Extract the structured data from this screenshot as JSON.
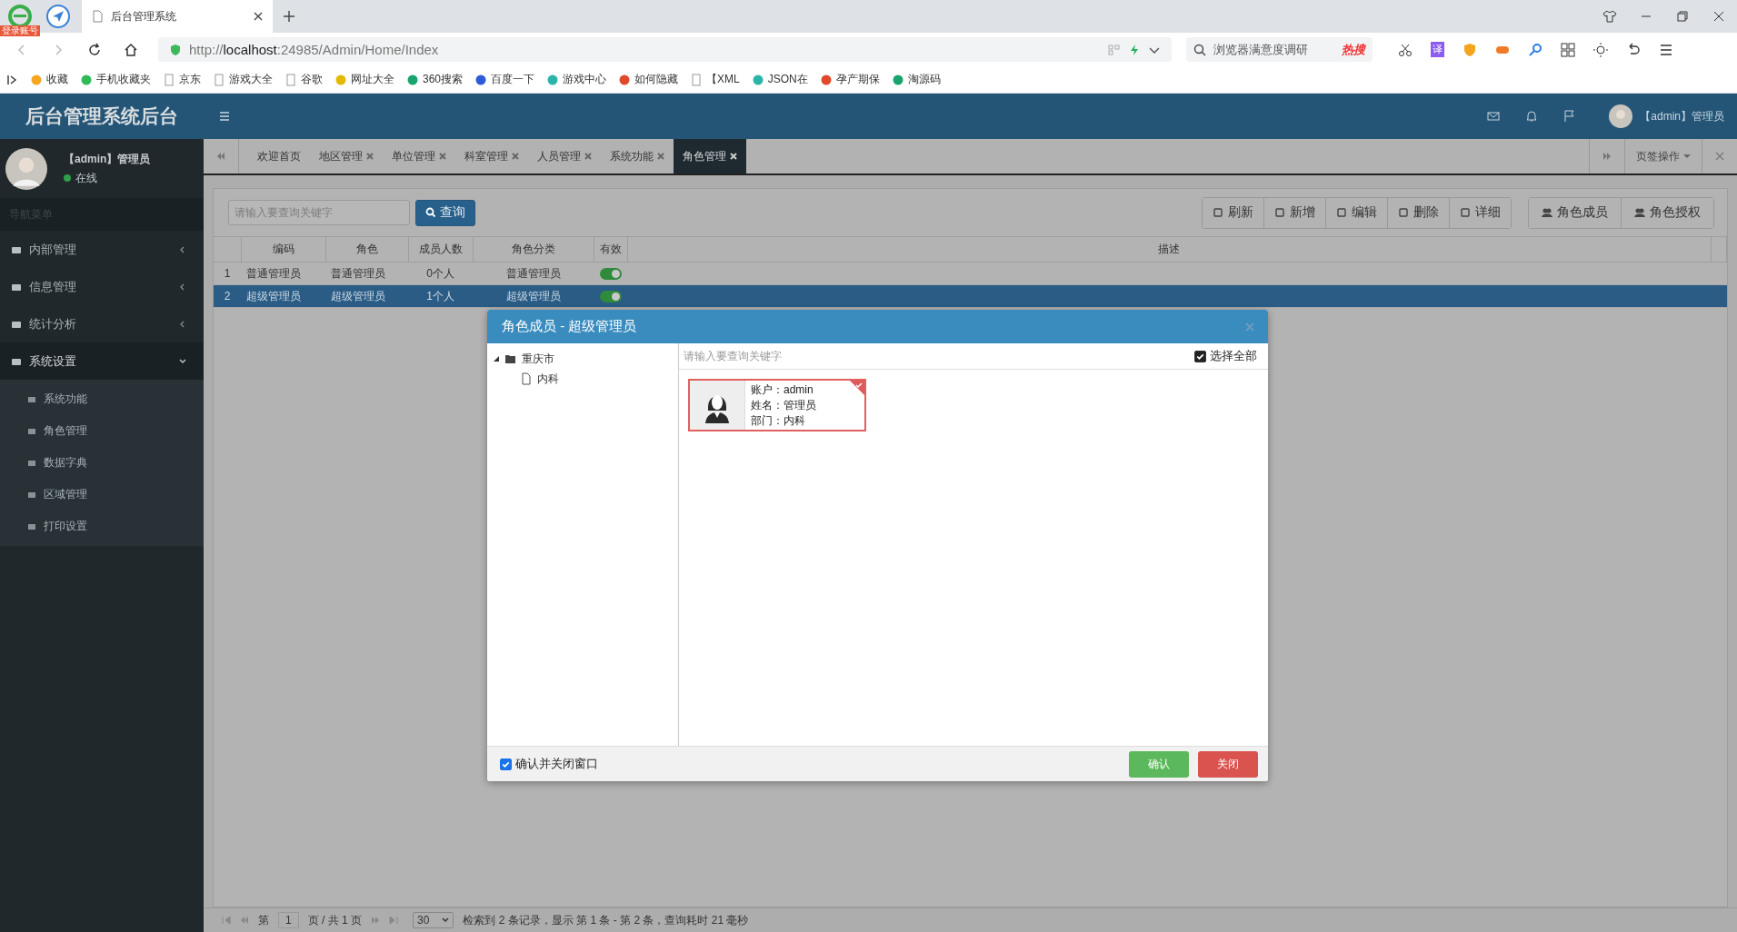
{
  "browser": {
    "badge": "登录账号",
    "tabs": [
      {
        "title": "后台管理系统",
        "selected": true
      }
    ],
    "address": {
      "prefix": "http://",
      "host": "localhost",
      "rest": ":24985/Admin/Home/Index"
    },
    "search": {
      "placeholder": "浏览器满意度调研",
      "hot": "热搜"
    },
    "ext_label": "译",
    "bookmarks": [
      {
        "label": "收藏",
        "kind": "star"
      },
      {
        "label": "手机收藏夹",
        "kind": "phone"
      },
      {
        "label": "京东",
        "kind": "page"
      },
      {
        "label": "游戏大全",
        "kind": "page"
      },
      {
        "label": "谷歌",
        "kind": "page"
      },
      {
        "label": "网址大全",
        "kind": "globe"
      },
      {
        "label": "360搜索",
        "kind": "ring"
      },
      {
        "label": "百度一下",
        "kind": "paw"
      },
      {
        "label": "游戏中心",
        "kind": "gear"
      },
      {
        "label": "如何隐藏",
        "kind": "red"
      },
      {
        "label": "【XML",
        "kind": "page"
      },
      {
        "label": "JSON在",
        "kind": "gear"
      },
      {
        "label": "孕产期保",
        "kind": "red"
      },
      {
        "label": "淘源码",
        "kind": "ring"
      }
    ]
  },
  "app": {
    "title": "后台管理系统后台",
    "user": {
      "name": "【admin】管理员",
      "status": "在线"
    },
    "header_user": "【admin】管理员",
    "nav_header": "导航菜单",
    "menu": [
      {
        "label": "内部管理",
        "expanded": false
      },
      {
        "label": "信息管理",
        "expanded": false
      },
      {
        "label": "统计分析",
        "expanded": false
      },
      {
        "label": "系统设置",
        "expanded": true,
        "children": [
          {
            "label": "系统功能"
          },
          {
            "label": "角色管理"
          },
          {
            "label": "数据字典"
          },
          {
            "label": "区域管理"
          },
          {
            "label": "打印设置"
          }
        ]
      }
    ],
    "tabs": [
      {
        "label": "欢迎首页",
        "selected": false,
        "closable": false
      },
      {
        "label": "地区管理",
        "selected": false,
        "closable": true
      },
      {
        "label": "单位管理",
        "selected": false,
        "closable": true
      },
      {
        "label": "科室管理",
        "selected": false,
        "closable": true
      },
      {
        "label": "人员管理",
        "selected": false,
        "closable": true
      },
      {
        "label": "系统功能",
        "selected": false,
        "closable": true
      },
      {
        "label": "角色管理",
        "selected": true,
        "closable": true
      }
    ],
    "tab_ops": "页签操作",
    "search": {
      "placeholder": "请输入要查询关键字",
      "button": "查询"
    },
    "toolbar": [
      "刷新",
      "新增",
      "编辑",
      "删除",
      "详细"
    ],
    "toolbar2": [
      "角色成员",
      "角色授权"
    ],
    "table": {
      "columns": [
        "编码",
        "角色",
        "成员人数",
        "角色分类",
        "有效",
        "描述"
      ],
      "rows": [
        {
          "index": "1",
          "code": "普通管理员",
          "role": "普通管理员",
          "members": "0个人",
          "category": "普通管理员",
          "valid": true,
          "selected": false
        },
        {
          "index": "2",
          "code": "超级管理员",
          "role": "超级管理员",
          "members": "1个人",
          "category": "超级管理员",
          "valid": true,
          "selected": true
        }
      ]
    },
    "pager": {
      "page_prefix": "第",
      "page": "1",
      "page_suffix": "页 / 共 1 页",
      "page_size": "30",
      "info": "检索到 2 条记录，显示 第 1 条 - 第 2 条，查询耗时 21 毫秒"
    }
  },
  "dialog": {
    "title": "角色成员 - 超级管理员",
    "tree": [
      {
        "label": "重庆市",
        "expanded": true,
        "children": [
          {
            "label": "内科"
          }
        ]
      }
    ],
    "search_placeholder": "请输入要查询关键字",
    "select_all": {
      "label": "选择全部",
      "checked": true
    },
    "members": [
      {
        "account": "账户：admin",
        "name": "姓名：管理员",
        "dept": "部门：内科",
        "selected": true
      }
    ],
    "confirm_close": {
      "label": "确认并关闭窗口",
      "checked": true
    },
    "buttons": [
      {
        "label": "确认",
        "kind": "ok"
      },
      {
        "label": "关闭",
        "kind": "close"
      }
    ]
  }
}
